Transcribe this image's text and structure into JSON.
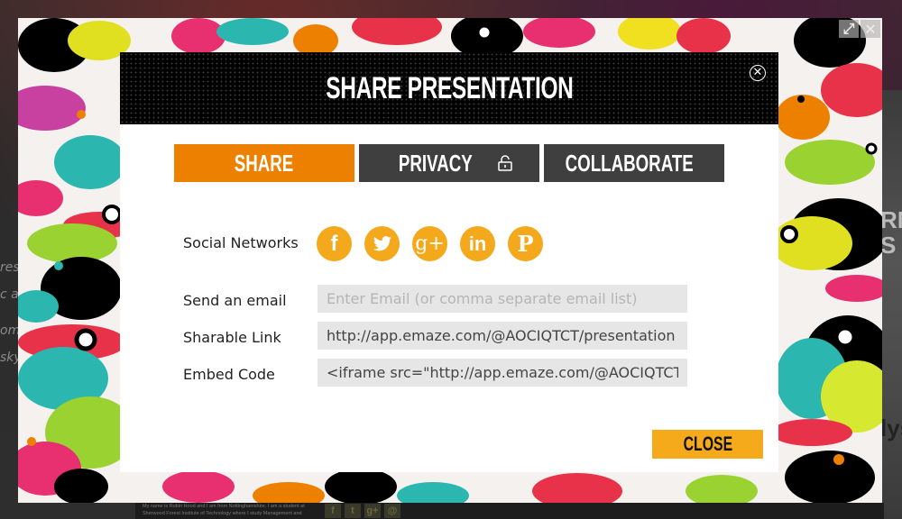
{
  "background": {
    "left_text_fragments": [
      "res",
      "c an",
      "om",
      "sky"
    ],
    "right_text_fragments": [
      "RN",
      "S",
      "lys"
    ],
    "footer_bio": "My name is Robin Hood and I am from Nottinghamshire. I am a student at Sherwood Forest Institute of Technology where I study Management and",
    "footer_icons": [
      "f",
      "t",
      "g+",
      "@"
    ]
  },
  "frame_controls": {
    "expand_label": "⤢",
    "close_label": "✕"
  },
  "modal": {
    "title": "SHARE PRESENTATION",
    "close_icon": "✕",
    "tabs": [
      {
        "label": "SHARE",
        "active": true,
        "icon": ""
      },
      {
        "label": "PRIVACY",
        "active": false,
        "icon": "unlock-icon"
      },
      {
        "label": "COLLABORATE",
        "active": false,
        "icon": "users-icon"
      }
    ],
    "social_label": "Social Networks",
    "social_networks": [
      {
        "name": "facebook",
        "glyph": "f"
      },
      {
        "name": "twitter",
        "glyph": "🐦"
      },
      {
        "name": "google-plus",
        "glyph": "g+"
      },
      {
        "name": "linkedin",
        "glyph": "in"
      },
      {
        "name": "pinterest",
        "glyph": "P"
      }
    ],
    "email_label": "Send an email",
    "email_placeholder": "Enter Email (or comma separate email list)",
    "email_value": "",
    "link_label": "Sharable Link",
    "link_value": "http://app.emaze.com/@AOCIQTCT/presentation",
    "embed_label": "Embed Code",
    "embed_value": "<iframe src=\"http://app.emaze.com/@AOCIQTCT/presentation\"",
    "close_button": "CLOSE",
    "colors": {
      "active_tab": "#ee8000",
      "inactive_tab": "#3f3f3f",
      "social": "#f4a81c",
      "close_button": "#f4aa1b"
    }
  }
}
